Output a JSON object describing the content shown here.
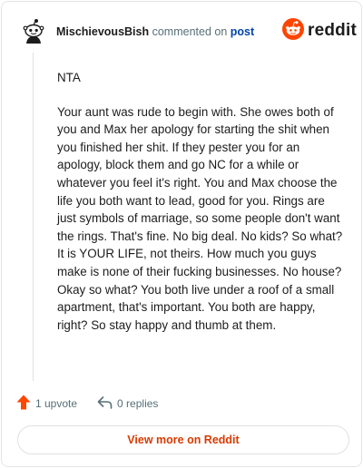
{
  "header": {
    "author": "MischievousBish",
    "commented_text": "commented on",
    "post_link": "post",
    "logo_text": "reddit"
  },
  "comment": {
    "paragraphs": [
      "NTA",
      "Your aunt was rude to begin with. She owes both of you and Max her apology for starting the shit when you finished her shit. If they pester you for an apology, block them and go NC for a while or whatever you feel it's right. You and Max choose the life you both want to lead, good for you. Rings are just symbols of marriage, so some people don't want the rings. That's fine. No big deal. No kids? So what? It is YOUR LIFE, not theirs. How much you guys make is none of their fucking businesses. No house? Okay so what? You both live under a roof of a small apartment, that's important. You both are happy, right? So stay happy and thumb at them."
    ]
  },
  "actions": {
    "upvote_label": "1 upvote",
    "replies_label": "0 replies"
  },
  "footer": {
    "view_more_label": "View more on Reddit"
  },
  "colors": {
    "brand_orange": "#ff4500",
    "link_blue": "#0045ac",
    "cta_text": "#d93a00",
    "muted": "#576f76"
  },
  "icons": {
    "avatar": "snoo-avatar-icon",
    "logo": "reddit-logo-icon",
    "upvote": "upvote-arrow-icon",
    "reply": "reply-arrow-icon"
  }
}
